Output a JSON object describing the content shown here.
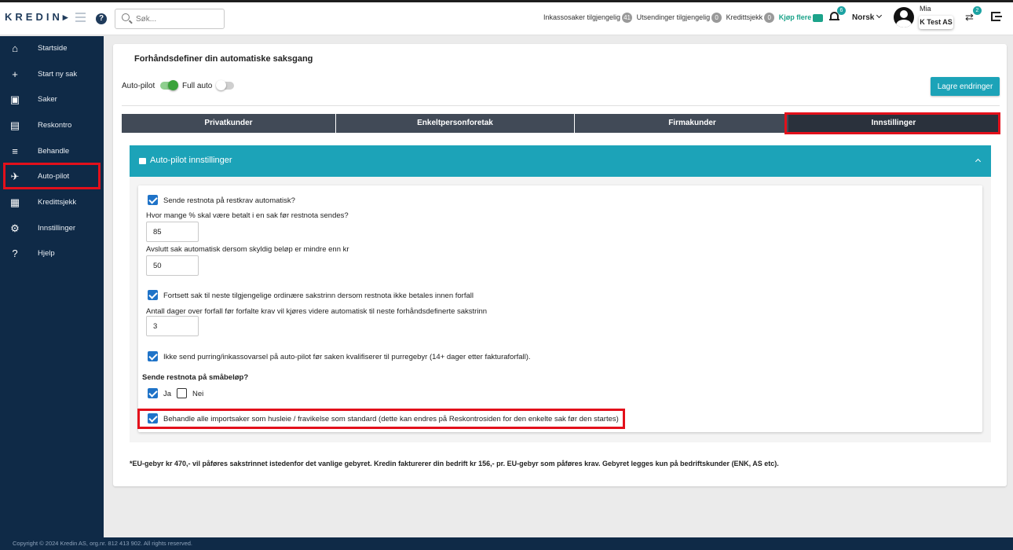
{
  "brand": {
    "logo_text": "KREDIN",
    "accent": "#1ca3b8",
    "highlight": "#e3101b",
    "sidebar_bg": "#0f2a47"
  },
  "header": {
    "help_label": "?",
    "search_placeholder": "Søk...",
    "counters": [
      {
        "label": "Inkassosaker tilgjengelig",
        "count": "41"
      },
      {
        "label": "Utsendinger tilgjengelig",
        "count": "0"
      },
      {
        "label": "Kredittsjekk",
        "count": "0"
      }
    ],
    "buy_more": "Kjøp flere",
    "notifications_count": "6",
    "language": "Norsk",
    "user_name": "Mia",
    "company": "K Test AS",
    "switch_count": "2"
  },
  "sidebar": {
    "items": [
      {
        "label": "Startside",
        "icon": "home-icon"
      },
      {
        "label": "Start ny sak",
        "icon": "plus-icon"
      },
      {
        "label": "Saker",
        "icon": "briefcase-icon"
      },
      {
        "label": "Reskontro",
        "icon": "document-icon"
      },
      {
        "label": "Behandle",
        "icon": "list-check-icon"
      },
      {
        "label": "Auto-pilot",
        "icon": "airplane-icon"
      },
      {
        "label": "Kredittsjekk",
        "icon": "id-card-icon"
      },
      {
        "label": "Innstillinger",
        "icon": "gear-icon"
      },
      {
        "label": "Hjelp",
        "icon": "question-icon"
      }
    ]
  },
  "main": {
    "title": "Forhåndsdefiner din automatiske saksgang",
    "toggles": [
      {
        "label": "Auto-pilot",
        "on": true
      },
      {
        "label": "Full auto",
        "on": false
      }
    ],
    "save_label": "Lagre endringer",
    "tabs": [
      {
        "label": "Privatkunder",
        "active": false
      },
      {
        "label": "Enkeltpersonforetak",
        "active": false
      },
      {
        "label": "Firmakunder",
        "active": false
      },
      {
        "label": "Innstillinger",
        "active": true
      }
    ],
    "panel": {
      "title": "Auto-pilot innstillinger",
      "send_restnota": {
        "label": "Sende restnota på restkrav automatisk?",
        "checked": true
      },
      "percent_label": "Hvor mange % skal være betalt i en sak før restnota sendes?",
      "percent_value": "85",
      "close_label": "Avslutt sak automatisk dersom skyldig beløp er mindre enn kr",
      "close_value": "50",
      "continue_step": {
        "label": "Fortsett sak til neste tilgjengelige ordinære sakstrinn dersom restnota ikke betales innen forfall",
        "checked": true
      },
      "days_label": "Antall dager over forfall før forfalte krav vil kjøres videre automatisk til neste forhåndsdefinerte sakstrinn",
      "days_value": "3",
      "no_reminder": {
        "label": "Ikke send purring/inkassovarsel på auto-pilot før saken kvalifiserer til purregebyr (14+ dager etter fakturaforfall).",
        "checked": true
      },
      "small_amounts_heading": "Sende restnota på småbeløp?",
      "yes": {
        "label": "Ja",
        "checked": true
      },
      "no": {
        "label": "Nei",
        "checked": false
      },
      "rent_default": {
        "label": "Behandle alle importsaker som husleie / fravikelse som standard (dette kan endres på Reskontrosiden for den enkelte sak før den startes)",
        "checked": true
      }
    },
    "footnote": "*EU-gebyr kr 470,- vil påføres sakstrinnet istedenfor det vanlige gebyret. Kredin fakturerer din bedrift kr 156,- pr. EU-gebyr som påføres krav. Gebyret legges kun på bedriftskunder (ENK, AS etc)."
  },
  "footer": {
    "copyright": "Copyright © 2024 Kredin AS, org.nr. 812 413 902. All rights reserved."
  }
}
